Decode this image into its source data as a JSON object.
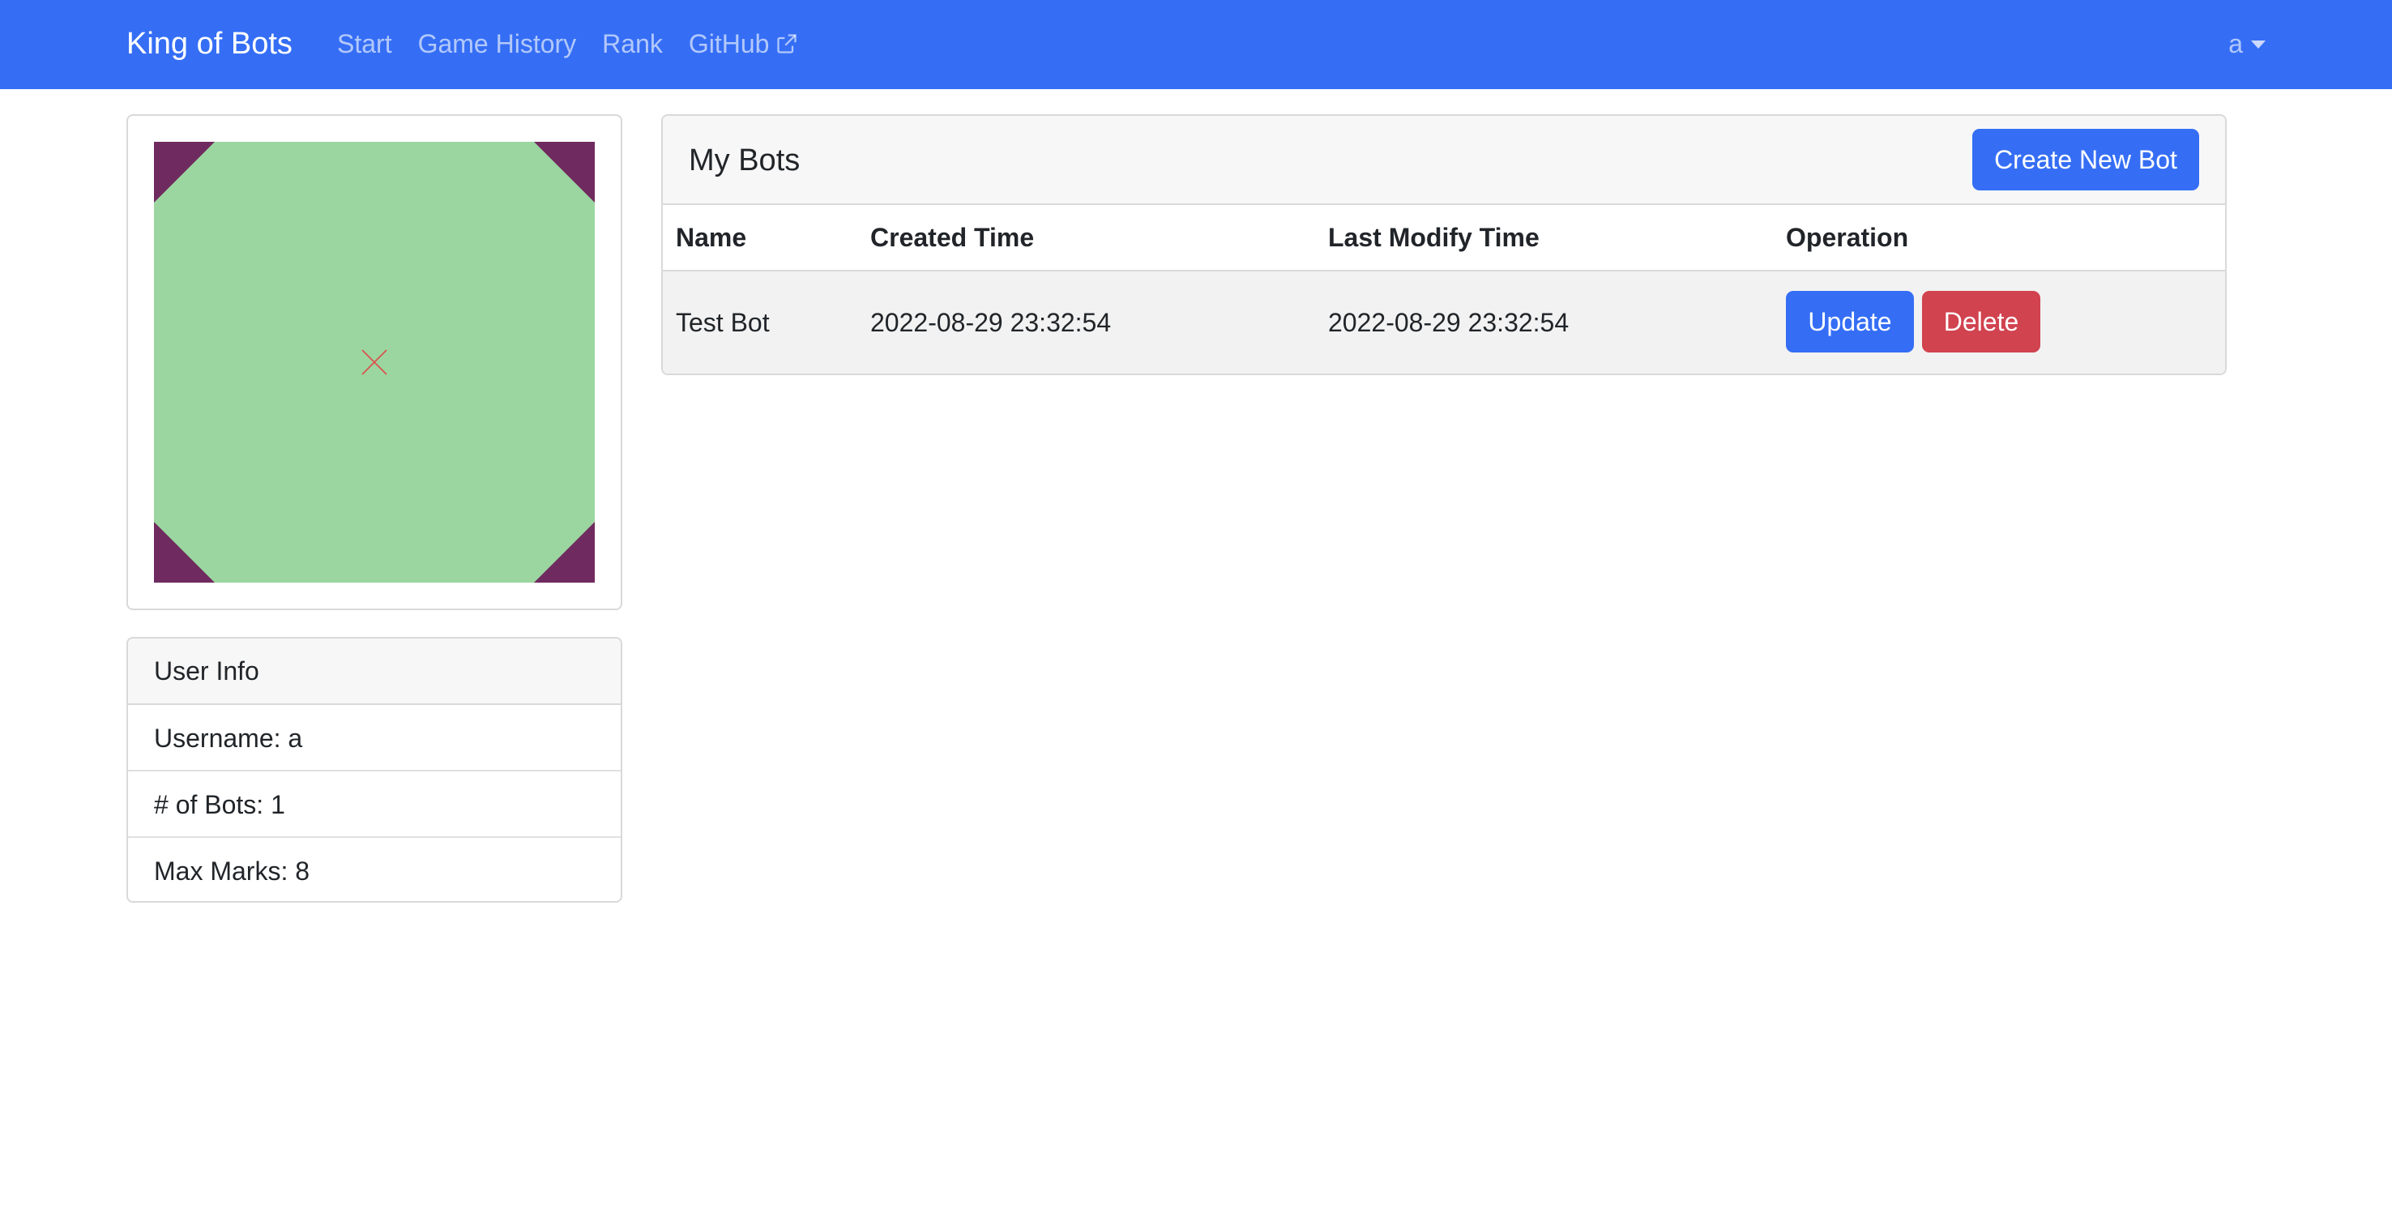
{
  "navbar": {
    "brand": "King of Bots",
    "links": [
      "Start",
      "Game History",
      "Rank",
      "GitHub"
    ],
    "github_icon": "external-link-icon",
    "user": "a",
    "user_icon": "caret-down-icon",
    "background_color": "#356ef5"
  },
  "avatar": {
    "board_color": "#9bd6a0",
    "corner_color": "#6f2a5f",
    "mark_color": "#d9534f",
    "mark_icon": "close-icon"
  },
  "user_info": {
    "header": "User Info",
    "username": "Username: a",
    "bot_count": "# of Bots: 1",
    "max_marks": "Max Marks: 8"
  },
  "bots": {
    "title": "My Bots",
    "create_label": "Create New Bot",
    "columns": [
      "Name",
      "Created Time",
      "Last Modify Time",
      "Operation"
    ],
    "rows": [
      {
        "name": "Test Bot",
        "created": "2022-08-29 23:32:54",
        "modified": "2022-08-29 23:32:54",
        "update_label": "Update",
        "delete_label": "Delete"
      }
    ]
  }
}
